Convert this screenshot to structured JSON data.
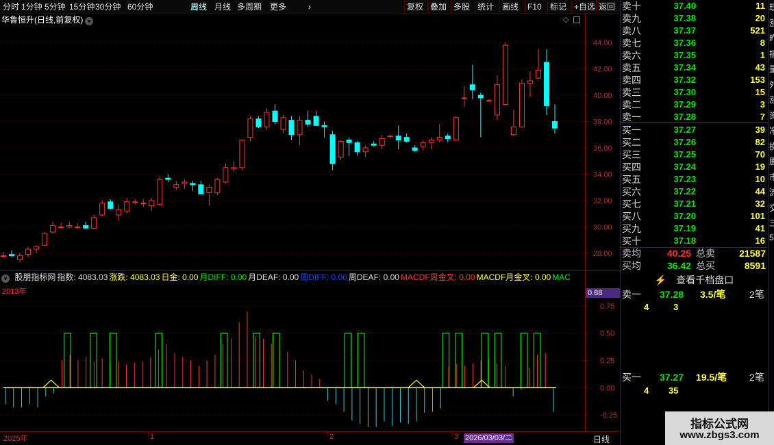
{
  "toolbar": {
    "items": [
      "分时",
      "1分钟",
      "5分钟",
      "15分钟",
      "30分钟",
      "60分钟",
      "日线",
      "周线",
      "月线",
      "多周期",
      "更多"
    ],
    "more_arrow": "›",
    "right_items": [
      "复权",
      "叠加",
      "多股",
      "统计",
      "画线",
      "F10",
      "标记",
      "+自选",
      "返回"
    ],
    "active": "日线"
  },
  "stock_title": "华鲁恒升(日线,前复权)",
  "icons": {
    "collapse": "chevron-down-icon",
    "diamond": "diamond-icon",
    "square": "square-icon",
    "bolt": "lightning-icon"
  },
  "colors": {
    "up": "#ff3333",
    "down": "#00ffff",
    "grid": "#7a0000",
    "bar_up": "#00e600",
    "bar_dn": "#40c8d8",
    "yellow": "#ffff40"
  },
  "chart_data": [
    {
      "type": "candlestick",
      "title": "华鲁恒升(日线,前复权)",
      "y_ticks": [
        "44.00",
        "42.00",
        "40.00",
        "38.00",
        "36.00",
        "34.00",
        "32.00",
        "30.00",
        "28.00"
      ],
      "ylim": [
        27,
        45
      ],
      "candles": [
        {
          "o": 27.8,
          "h": 28.1,
          "l": 27.6,
          "c": 27.8
        },
        {
          "o": 27.9,
          "h": 28.2,
          "l": 27.7,
          "c": 27.8
        },
        {
          "o": 27.5,
          "h": 28.0,
          "l": 27.3,
          "c": 27.8
        },
        {
          "o": 27.9,
          "h": 28.5,
          "l": 27.7,
          "c": 28.3
        },
        {
          "o": 28.3,
          "h": 28.6,
          "l": 28.0,
          "c": 28.5
        },
        {
          "o": 28.6,
          "h": 29.6,
          "l": 28.5,
          "c": 29.5
        },
        {
          "o": 29.6,
          "h": 30.4,
          "l": 29.5,
          "c": 30.1
        },
        {
          "o": 30.0,
          "h": 30.3,
          "l": 29.8,
          "c": 30.0
        },
        {
          "o": 30.0,
          "h": 30.4,
          "l": 29.9,
          "c": 30.1
        },
        {
          "o": 30.0,
          "h": 30.3,
          "l": 29.8,
          "c": 30.0
        },
        {
          "o": 30.1,
          "h": 30.4,
          "l": 29.8,
          "c": 29.9
        },
        {
          "o": 29.9,
          "h": 30.9,
          "l": 29.8,
          "c": 30.7
        },
        {
          "o": 30.9,
          "h": 32.0,
          "l": 30.8,
          "c": 31.8
        },
        {
          "o": 31.9,
          "h": 32.1,
          "l": 31.3,
          "c": 31.4
        },
        {
          "o": 30.9,
          "h": 31.7,
          "l": 30.5,
          "c": 31.3
        },
        {
          "o": 31.2,
          "h": 32.2,
          "l": 31.0,
          "c": 31.9
        },
        {
          "o": 31.9,
          "h": 32.1,
          "l": 31.7,
          "c": 31.9
        },
        {
          "o": 31.8,
          "h": 32.1,
          "l": 31.5,
          "c": 31.8
        },
        {
          "o": 31.6,
          "h": 32.2,
          "l": 31.2,
          "c": 32.0
        },
        {
          "o": 31.7,
          "h": 33.8,
          "l": 31.6,
          "c": 33.6
        },
        {
          "o": 33.7,
          "h": 34.0,
          "l": 33.4,
          "c": 33.6
        },
        {
          "o": 33.0,
          "h": 33.5,
          "l": 32.8,
          "c": 33.2
        },
        {
          "o": 33.3,
          "h": 33.6,
          "l": 32.9,
          "c": 33.4
        },
        {
          "o": 33.3,
          "h": 33.5,
          "l": 32.7,
          "c": 33.2
        },
        {
          "o": 33.2,
          "h": 33.5,
          "l": 32.6,
          "c": 32.5
        },
        {
          "o": 32.6,
          "h": 33.2,
          "l": 31.6,
          "c": 33.0
        },
        {
          "o": 32.6,
          "h": 33.7,
          "l": 32.4,
          "c": 33.6
        },
        {
          "o": 33.4,
          "h": 34.8,
          "l": 33.3,
          "c": 34.5
        },
        {
          "o": 34.4,
          "h": 35.0,
          "l": 34.2,
          "c": 34.5
        },
        {
          "o": 34.5,
          "h": 36.6,
          "l": 34.3,
          "c": 36.6
        },
        {
          "o": 36.8,
          "h": 38.4,
          "l": 36.5,
          "c": 38.2
        },
        {
          "o": 38.2,
          "h": 38.4,
          "l": 37.5,
          "c": 37.6
        },
        {
          "o": 37.6,
          "h": 39.0,
          "l": 37.4,
          "c": 38.7
        },
        {
          "o": 38.8,
          "h": 39.3,
          "l": 37.8,
          "c": 38.0
        },
        {
          "o": 37.4,
          "h": 38.5,
          "l": 37.1,
          "c": 38.3
        },
        {
          "o": 38.1,
          "h": 38.4,
          "l": 36.6,
          "c": 37.0
        },
        {
          "o": 37.0,
          "h": 38.4,
          "l": 36.2,
          "c": 38.1
        },
        {
          "o": 38.1,
          "h": 38.8,
          "l": 37.6,
          "c": 37.8
        },
        {
          "o": 38.4,
          "h": 38.8,
          "l": 37.8,
          "c": 37.7
        },
        {
          "o": 37.7,
          "h": 38.0,
          "l": 36.8,
          "c": 37.6
        },
        {
          "o": 37.0,
          "h": 37.3,
          "l": 34.3,
          "c": 34.8
        },
        {
          "o": 35.3,
          "h": 36.6,
          "l": 35.1,
          "c": 36.5
        },
        {
          "o": 36.6,
          "h": 36.8,
          "l": 35.4,
          "c": 36.4
        },
        {
          "o": 36.4,
          "h": 36.5,
          "l": 35.4,
          "c": 35.7
        },
        {
          "o": 35.7,
          "h": 36.2,
          "l": 35.3,
          "c": 36.0
        },
        {
          "o": 36.3,
          "h": 36.5,
          "l": 36.1,
          "c": 36.2
        },
        {
          "o": 36.2,
          "h": 37.0,
          "l": 35.9,
          "c": 36.7
        },
        {
          "o": 36.9,
          "h": 37.0,
          "l": 36.7,
          "c": 36.9
        },
        {
          "o": 36.9,
          "h": 37.7,
          "l": 35.9,
          "c": 36.6
        },
        {
          "o": 36.8,
          "h": 37.1,
          "l": 36.4,
          "c": 36.5
        },
        {
          "o": 36.0,
          "h": 36.2,
          "l": 35.7,
          "c": 35.8
        },
        {
          "o": 36.1,
          "h": 36.6,
          "l": 35.8,
          "c": 36.4
        },
        {
          "o": 36.4,
          "h": 36.8,
          "l": 35.9,
          "c": 36.6
        },
        {
          "o": 36.6,
          "h": 37.8,
          "l": 36.4,
          "c": 36.8
        },
        {
          "o": 36.9,
          "h": 37.1,
          "l": 36.4,
          "c": 36.7
        },
        {
          "o": 36.6,
          "h": 38.4,
          "l": 36.6,
          "c": 38.3
        },
        {
          "o": 39.8,
          "h": 40.7,
          "l": 39.1,
          "c": 39.8
        },
        {
          "o": 40.8,
          "h": 42.3,
          "l": 39.7,
          "c": 40.4
        },
        {
          "o": 40.0,
          "h": 40.2,
          "l": 36.8,
          "c": 39.8
        },
        {
          "o": 39.6,
          "h": 39.7,
          "l": 39.5,
          "c": 39.6
        },
        {
          "o": 38.5,
          "h": 41.5,
          "l": 38.1,
          "c": 40.8
        },
        {
          "o": 39.3,
          "h": 44.0,
          "l": 39.2,
          "c": 43.8
        },
        {
          "o": 37.0,
          "h": 38.9,
          "l": 36.9,
          "c": 37.6
        },
        {
          "o": 37.6,
          "h": 41.2,
          "l": 37.5,
          "c": 40.9
        },
        {
          "o": 40.9,
          "h": 41.8,
          "l": 39.9,
          "c": 41.1
        },
        {
          "o": 41.3,
          "h": 43.5,
          "l": 41.2,
          "c": 41.9
        },
        {
          "o": 42.5,
          "h": 43.5,
          "l": 38.5,
          "c": 39.2
        },
        {
          "o": 38.0,
          "h": 39.3,
          "l": 37.1,
          "c": 37.5
        }
      ]
    },
    {
      "type": "bar",
      "title": "股朋指标网",
      "y_ticks": [
        "0.75",
        "0.50",
        "0.25",
        "0.00",
        "-0.25"
      ],
      "ylim": [
        -0.4,
        0.95
      ],
      "current_value": "0.88",
      "bars": [
        -0.15,
        -0.18,
        -0.18,
        -0.15,
        -0.18,
        -0.08,
        -0.05,
        0.25,
        0.3,
        0.25,
        0.28,
        0.24,
        0.27,
        0.22,
        0.24,
        0.21,
        0.23,
        0.24,
        0.28,
        0.35,
        0.4,
        0.32,
        0.28,
        0.25,
        0.2,
        0.25,
        0.3,
        0.4,
        0.45,
        0.6,
        0.7,
        0.47,
        0.45,
        0.4,
        0.37,
        0.33,
        0.25,
        0.16,
        0.12,
        0.08,
        -0.12,
        -0.15,
        -0.22,
        -0.3,
        -0.33,
        -0.36,
        -0.36,
        -0.31,
        -0.35,
        -0.32,
        -0.33,
        -0.31,
        -0.23,
        -0.22,
        -0.19,
        0.19,
        0.22,
        0.2,
        0.22,
        0.25,
        0.27,
        0.22,
        0.2,
        -0.08,
        -0.02,
        0.18,
        0.3,
        0.32,
        -0.22
      ],
      "green_pulses": [
        [
          9,
          10
        ],
        [
          13,
          14
        ],
        [
          16,
          17
        ],
        [
          23,
          24
        ],
        [
          33,
          34
        ],
        [
          38,
          39
        ],
        [
          41,
          42
        ],
        [
          52,
          53
        ],
        [
          54,
          55
        ],
        [
          67,
          68
        ],
        [
          69,
          70
        ],
        [
          73,
          74
        ],
        [
          75,
          76
        ],
        [
          79,
          80
        ],
        [
          81,
          82
        ]
      ],
      "yellow_pulses": [
        7,
        63,
        73
      ]
    }
  ],
  "indicator_bar": [
    {
      "t": "股朋指标网",
      "c": "#dcdcdc"
    },
    {
      "t": "指数: 4083.03",
      "c": "#dcdcdc"
    },
    {
      "t": "涨跌: 4083.03",
      "c": "#ffff40"
    },
    {
      "t": "日金: 0.00",
      "c": "#ffff40"
    },
    {
      "t": "月DIFF: 0.00",
      "c": "#00e600"
    },
    {
      "t": "月DEAF: 0.00",
      "c": "#dcdcdc"
    },
    {
      "t": "周DIFF: 0.00",
      "c": "#2040ff"
    },
    {
      "t": "周DEAF: 0.00",
      "c": "#dcdcdc"
    },
    {
      "t": "MACDF周金叉: 0.00",
      "c": "#ff3333"
    },
    {
      "t": "MACDF月金叉: 0.00",
      "c": "#ffff40"
    },
    {
      "t": "MAC",
      "c": "#00e600"
    }
  ],
  "year_label": "2013年",
  "bottom_axis": {
    "year": "2025年",
    "m1": "1",
    "m2": "2",
    "m3": "3",
    "date": "2026/03/03/二",
    "period": "日线"
  },
  "orderbook": {
    "asks": [
      {
        "label": "卖十",
        "price": "37.40",
        "vol": "11",
        "mark": "≑"
      },
      {
        "label": "卖九",
        "price": "37.38",
        "vol": "20"
      },
      {
        "label": "卖八",
        "price": "37.37",
        "vol": "521"
      },
      {
        "label": "卖七",
        "price": "37.36",
        "vol": "8"
      },
      {
        "label": "卖六",
        "price": "37.35",
        "vol": "1"
      },
      {
        "label": "卖五",
        "price": "37.34",
        "vol": "43"
      },
      {
        "label": "卖四",
        "price": "37.32",
        "vol": "153"
      },
      {
        "label": "卖三",
        "price": "37.30",
        "vol": "15"
      },
      {
        "label": "卖二",
        "price": "37.29",
        "vol": "3"
      },
      {
        "label": "卖一",
        "price": "37.28",
        "vol": "7"
      }
    ],
    "bids": [
      {
        "label": "买一",
        "price": "37.27",
        "vol": "39"
      },
      {
        "label": "买二",
        "price": "37.26",
        "vol": "82"
      },
      {
        "label": "买三",
        "price": "37.25",
        "vol": "70"
      },
      {
        "label": "买四",
        "price": "37.24",
        "vol": "19"
      },
      {
        "label": "买五",
        "price": "37.23",
        "vol": "10"
      },
      {
        "label": "买六",
        "price": "37.22",
        "vol": "44"
      },
      {
        "label": "买七",
        "price": "37.21",
        "vol": "32"
      },
      {
        "label": "买八",
        "price": "37.20",
        "vol": "101"
      },
      {
        "label": "买九",
        "price": "37.19",
        "vol": "41"
      },
      {
        "label": "买十",
        "price": "37.18",
        "vol": "16",
        "mark": "≑"
      }
    ],
    "sell_avg_label": "卖均",
    "sell_avg": "40.25",
    "sell_total_label": "总卖",
    "sell_total": "21587",
    "buy_avg_label": "买均",
    "buy_avg": "36.42",
    "buy_total_label": "总买",
    "buy_total": "8591"
  },
  "pankou": {
    "button": "查看千档盘口",
    "ask1_label": "卖一",
    "ask1_price": "37.28",
    "ask1_avg": "3.5/笔",
    "ask1_count": "2笔",
    "ask1_orders": [
      "4",
      "3"
    ],
    "bid1_label": "买一",
    "bid1_price": "37.27",
    "bid1_avg": "19.5/笔",
    "bid1_count": "2笔",
    "bid1_orders": [
      "4",
      "35"
    ]
  },
  "edge_chars": [
    "现",
    "涨",
    "昨",
    "振",
    "量",
    "外",
    "涨",
    "资",
    "净",
    "换",
    "股",
    "市",
    "流",
    "交",
    "三",
    "5"
  ],
  "watermark": {
    "line1": "指标公式网",
    "line2": "www.zbgs3.com"
  }
}
